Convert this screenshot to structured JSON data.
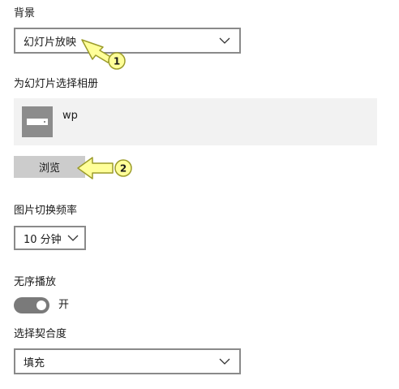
{
  "background": {
    "label": "背景",
    "selected": "幻灯片放映"
  },
  "album": {
    "label": "为幻灯片选择相册",
    "item_name": "wp",
    "browse_label": "浏览"
  },
  "interval": {
    "label": "图片切换频率",
    "selected": "10 分钟"
  },
  "shuffle": {
    "label": "无序播放",
    "state_label": "开"
  },
  "fit": {
    "label": "选择契合度",
    "selected": "填充"
  },
  "callouts": {
    "first": "1",
    "second": "2"
  },
  "colors": {
    "callout_fill": "#ffff99",
    "callout_stroke": "#9c9c2a",
    "toggle_on": "#7a7a7a",
    "button_bg": "#cccccc",
    "panel_bg": "#f2f2f2"
  }
}
